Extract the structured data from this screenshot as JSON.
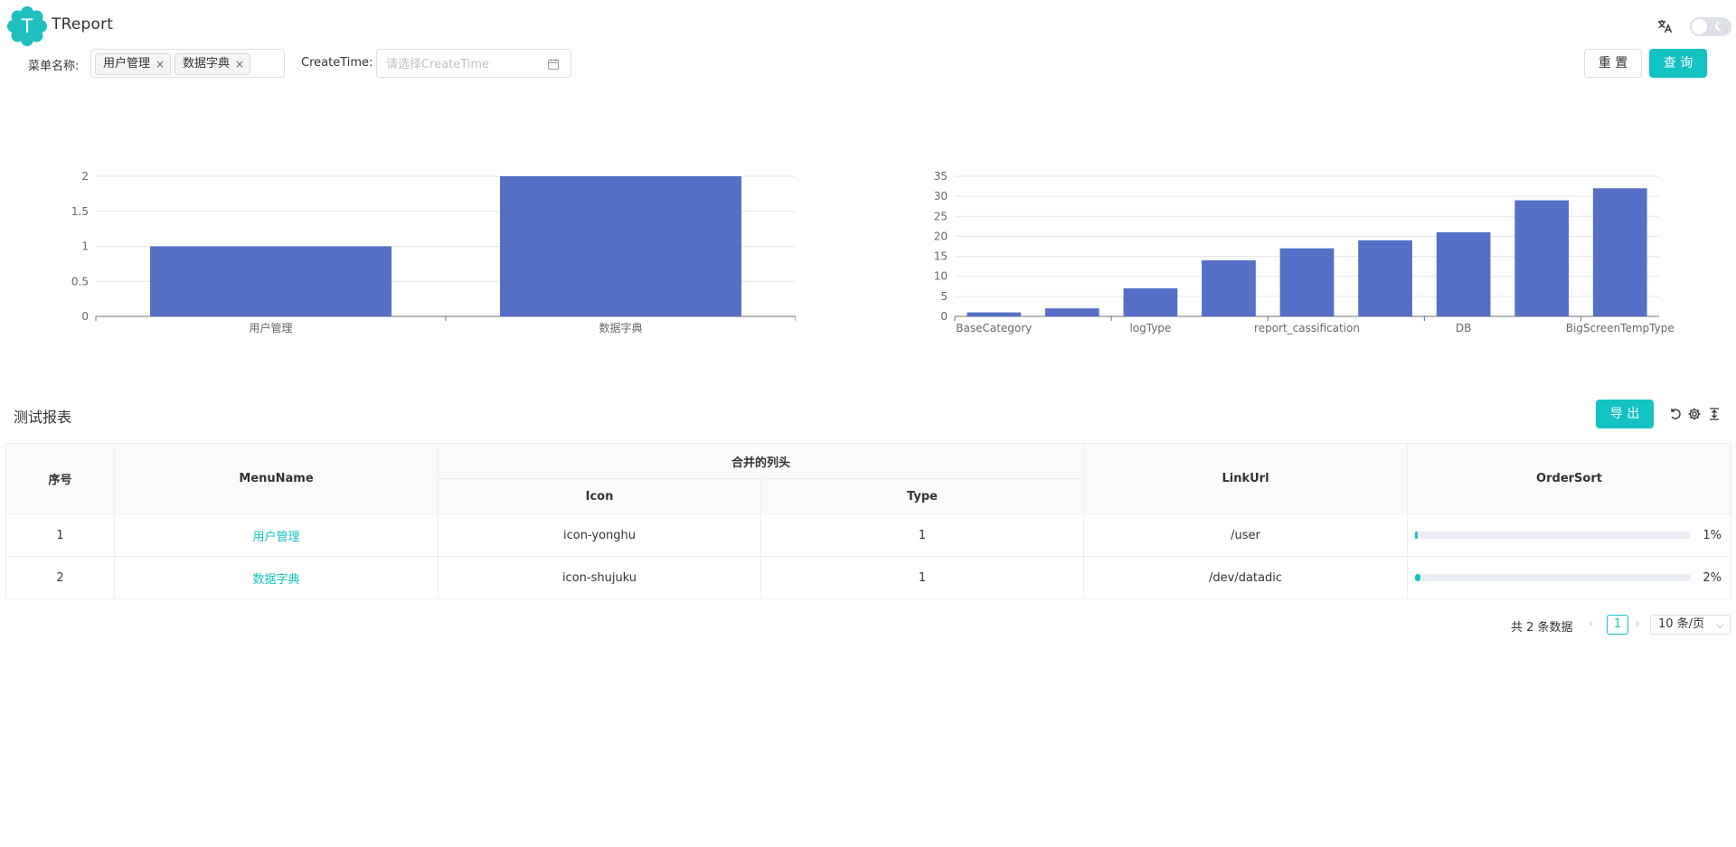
{
  "app": {
    "title": "TReport",
    "logo_letter": "T",
    "accent": "#13c2c2"
  },
  "filters": {
    "menu_label": "菜单名称:",
    "menu_tags": [
      "用户管理",
      "数据字典"
    ],
    "createtime_label": "CreateTime:",
    "createtime_placeholder": "请选择CreateTime",
    "reset_label": "重 置",
    "query_label": "查 询"
  },
  "chart_data": [
    {
      "type": "bar",
      "categories": [
        "用户管理",
        "数据字典"
      ],
      "values": [
        1,
        2
      ],
      "ylim": [
        0,
        2
      ],
      "yticks": [
        "0",
        "0.5",
        "1",
        "1.5",
        "2"
      ],
      "color": "#5470c6",
      "grid": true
    },
    {
      "type": "bar",
      "categories": [
        "BaseCategory",
        "",
        "logType",
        "",
        "report_cassification",
        "",
        "DB",
        "",
        "BigScreenTempType"
      ],
      "values": [
        1,
        2,
        7,
        14,
        17,
        19,
        21,
        29,
        32
      ],
      "ylim": [
        0,
        35
      ],
      "yticks": [
        "0",
        "5",
        "10",
        "15",
        "20",
        "25",
        "30",
        "35"
      ],
      "color": "#5470c6",
      "grid": true
    }
  ],
  "table": {
    "title": "测试报表",
    "export_label": "导 出",
    "headers": {
      "index": "序号",
      "menu_name": "MenuName",
      "merged": "合并的列头",
      "icon": "Icon",
      "type": "Type",
      "link_url": "LinkUrl",
      "order_sort": "OrderSort"
    },
    "rows": [
      {
        "index": "1",
        "menu_name": "用户管理",
        "icon": "icon-yonghu",
        "type": "1",
        "link_url": "/user",
        "order_sort_pct": "1%",
        "order_sort_value": 1
      },
      {
        "index": "2",
        "menu_name": "数据字典",
        "icon": "icon-shujuku",
        "type": "1",
        "link_url": "/dev/datadic",
        "order_sort_pct": "2%",
        "order_sort_value": 2
      }
    ]
  },
  "pagination": {
    "total_text": "共 2 条数据",
    "current_page": "1",
    "page_size": "10 条/页"
  }
}
